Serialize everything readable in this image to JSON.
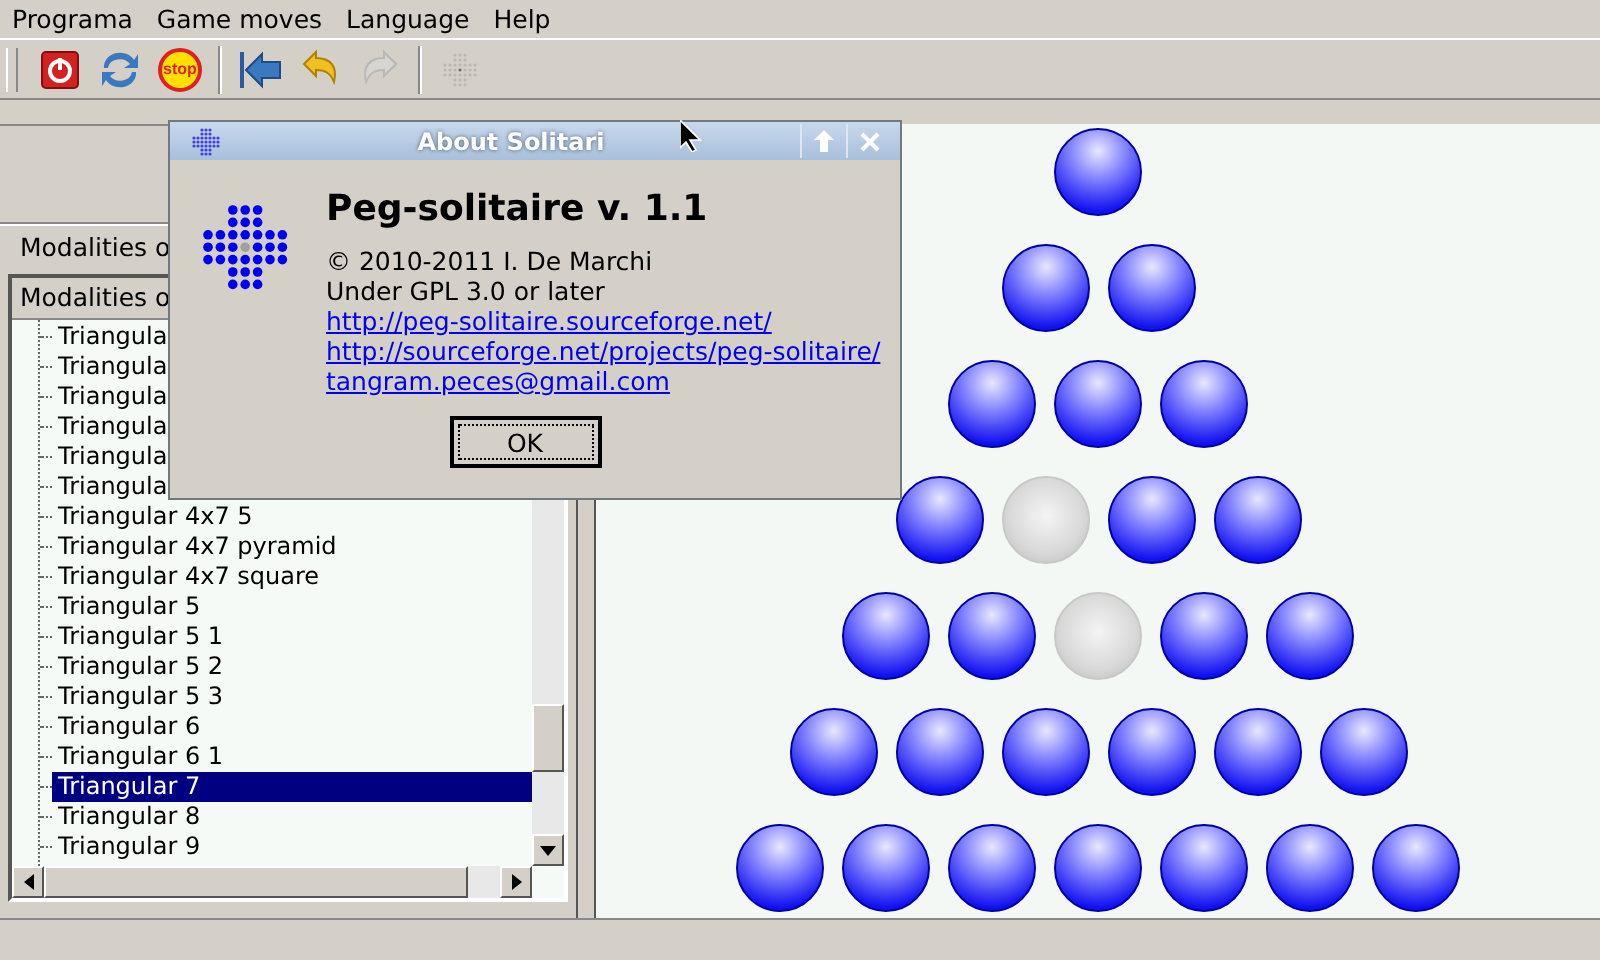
{
  "menu": [
    "Programa",
    "Game moves",
    "Language",
    "Help"
  ],
  "toolbar": [
    {
      "kind": "power",
      "disabled": false
    },
    {
      "kind": "refresh",
      "disabled": false
    },
    {
      "kind": "stop",
      "label": "stop",
      "disabled": false
    },
    {
      "kind": "sep"
    },
    {
      "kind": "back",
      "disabled": false
    },
    {
      "kind": "undo",
      "disabled": false
    },
    {
      "kind": "redo",
      "disabled": true
    },
    {
      "kind": "sep"
    },
    {
      "kind": "board",
      "disabled": true
    }
  ],
  "left_panel": {
    "tab": "Modalities o",
    "list_header": "Modalities o",
    "items": [
      {
        "label": "Triangula",
        "selected": false
      },
      {
        "label": "Triangula",
        "selected": false
      },
      {
        "label": "Triangula",
        "selected": false
      },
      {
        "label": "Triangula",
        "selected": false
      },
      {
        "label": "Triangula",
        "selected": false
      },
      {
        "label": "Triangula",
        "selected": false
      },
      {
        "label": "Triangular 4x7 5",
        "selected": false
      },
      {
        "label": "Triangular 4x7 pyramid",
        "selected": false
      },
      {
        "label": "Triangular 4x7 square",
        "selected": false
      },
      {
        "label": "Triangular 5",
        "selected": false
      },
      {
        "label": "Triangular 5 1",
        "selected": false
      },
      {
        "label": "Triangular 5 2",
        "selected": false
      },
      {
        "label": "Triangular 5 3",
        "selected": false
      },
      {
        "label": "Triangular 6",
        "selected": false
      },
      {
        "label": "Triangular 6 1",
        "selected": false
      },
      {
        "label": "Triangular 7",
        "selected": true
      },
      {
        "label": "Triangular 8",
        "selected": false
      },
      {
        "label": "Triangular 9",
        "selected": false
      }
    ]
  },
  "board": {
    "rows": [
      [
        {
          "peg": true
        }
      ],
      [
        {
          "peg": true
        },
        {
          "peg": true
        }
      ],
      [
        {
          "peg": true
        },
        {
          "peg": true
        },
        {
          "peg": true
        }
      ],
      [
        {
          "peg": true
        },
        {
          "peg": false
        },
        {
          "peg": true
        },
        {
          "peg": true
        }
      ],
      [
        {
          "peg": true
        },
        {
          "peg": true
        },
        {
          "peg": false
        },
        {
          "peg": true
        },
        {
          "peg": true
        }
      ],
      [
        {
          "peg": true
        },
        {
          "peg": true
        },
        {
          "peg": true
        },
        {
          "peg": true
        },
        {
          "peg": true
        },
        {
          "peg": true
        }
      ],
      [
        {
          "peg": true
        },
        {
          "peg": true
        },
        {
          "peg": true
        },
        {
          "peg": true
        },
        {
          "peg": true
        },
        {
          "peg": true
        },
        {
          "peg": true
        }
      ]
    ]
  },
  "dialog": {
    "title": "About Solitari",
    "heading": "Peg-solitaire v. 1.1",
    "lines": [
      "© 2010-2011 I. De Marchi",
      "Under GPL 3.0 or later"
    ],
    "links": [
      "http://peg-solitaire.sourceforge.net/",
      "http://sourceforge.net/projects/peg-solitaire/",
      "tangram.peces@gmail.com"
    ],
    "button": "OK"
  }
}
